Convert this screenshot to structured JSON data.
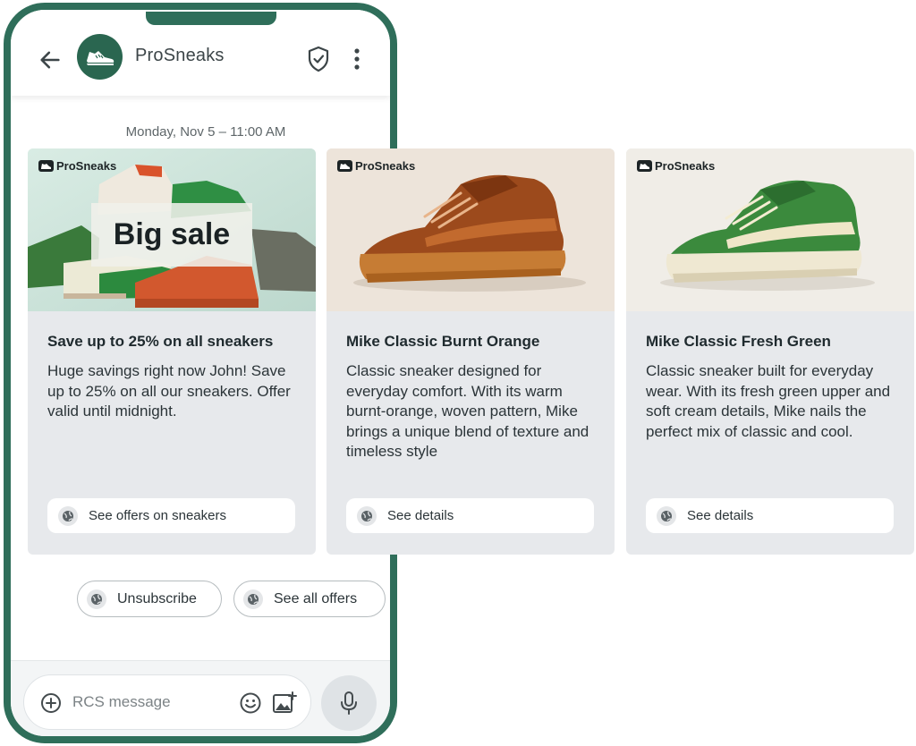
{
  "header": {
    "brand_name": "ProSneaks"
  },
  "conversation": {
    "timestamp": "Monday, Nov 5 – 11:00 AM"
  },
  "cards": [
    {
      "logo_text": "ProSneaks",
      "overlay_text": "Big sale",
      "title": "Save up to 25% on all sneakers",
      "description": "Huge savings right now John! Save up to 25% on all our sneakers. Offer valid until midnight.",
      "button_label": "See offers on sneakers"
    },
    {
      "logo_text": "ProSneaks",
      "title": "Mike Classic Burnt Orange",
      "description": "Classic sneaker designed for everyday comfort. With its warm burnt-orange, woven pattern, Mike brings a unique blend of texture and timeless style",
      "button_label": "See details"
    },
    {
      "logo_text": "ProSneaks",
      "title": "Mike Classic Fresh Green",
      "description": "Classic sneaker built for everyday wear. With its fresh green upper and soft cream details, Mike nails the perfect mix of classic and cool.",
      "button_label": "See details"
    }
  ],
  "suggestions": [
    {
      "label": "Unsubscribe"
    },
    {
      "label": "See all offers"
    }
  ],
  "composer": {
    "placeholder": "RCS message"
  },
  "colors": {
    "brand_green": "#2f6e5a",
    "card_bg": "#e7e9ec"
  }
}
